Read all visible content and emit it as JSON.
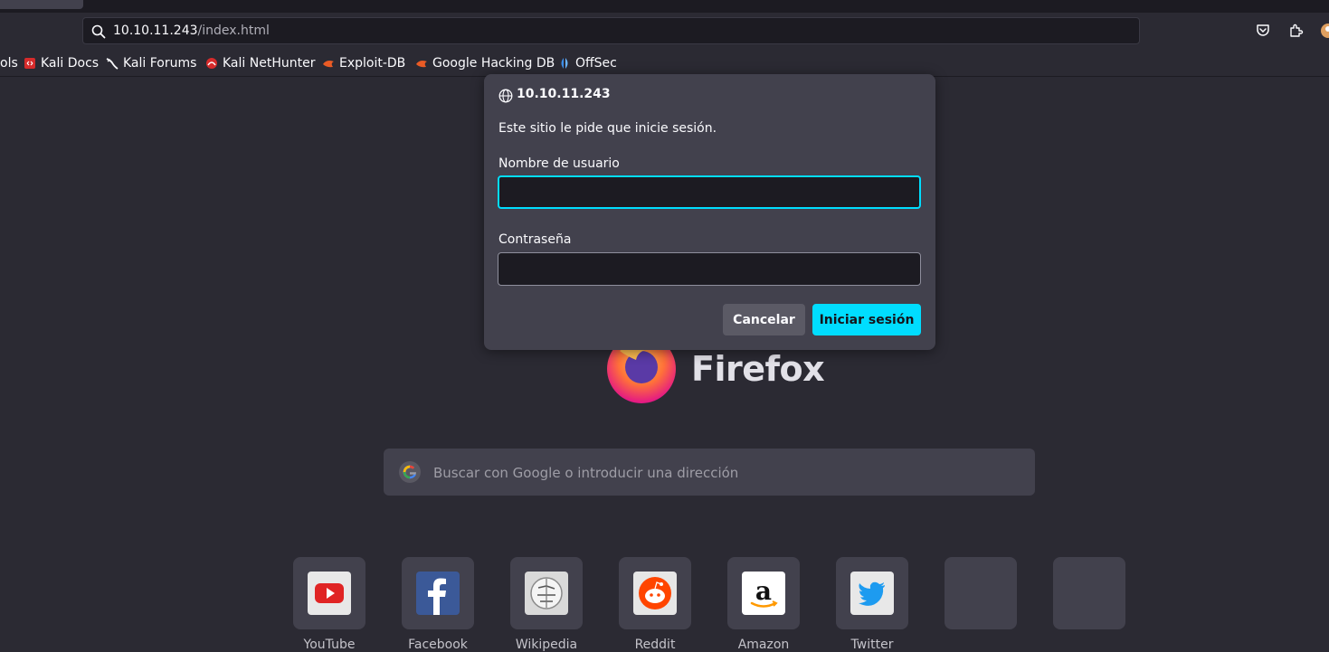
{
  "browser": {
    "url_host": "10.10.11.243",
    "url_path": "/index.html",
    "bookmarks": [
      {
        "label": "ols",
        "icon": "truncated"
      },
      {
        "label": "Kali Docs",
        "icon": "kali-docs-icon"
      },
      {
        "label": "Kali Forums",
        "icon": "kali-dragon-icon"
      },
      {
        "label": "Kali NetHunter",
        "icon": "nethunter-icon"
      },
      {
        "label": "Exploit-DB",
        "icon": "exploit-db-icon"
      },
      {
        "label": "Google Hacking DB",
        "icon": "ghdb-icon"
      },
      {
        "label": "OffSec",
        "icon": "offsec-icon"
      }
    ]
  },
  "newtab": {
    "brand": "Firefox",
    "search_placeholder": "Buscar con Google o introducir una dirección",
    "tiles": [
      {
        "label": "YouTube",
        "icon": "youtube-icon"
      },
      {
        "label": "Facebook",
        "icon": "facebook-icon"
      },
      {
        "label": "Wikipedia",
        "icon": "wikipedia-icon"
      },
      {
        "label": "Reddit",
        "icon": "reddit-icon"
      },
      {
        "label": "Amazon",
        "icon": "amazon-icon"
      },
      {
        "label": "Twitter",
        "icon": "twitter-icon"
      },
      {
        "label": "",
        "icon": ""
      },
      {
        "label": "",
        "icon": ""
      }
    ]
  },
  "auth_dialog": {
    "host": "10.10.11.243",
    "message": "Este sitio le pide que inicie sesión.",
    "username_label": "Nombre de usuario",
    "username_value": "",
    "password_label": "Contraseña",
    "password_value": "",
    "cancel_label": "Cancelar",
    "login_label": "Iniciar sesión"
  },
  "colors": {
    "accent": "#00ddff",
    "background": "#2b2a33",
    "dialog": "#42414d"
  }
}
